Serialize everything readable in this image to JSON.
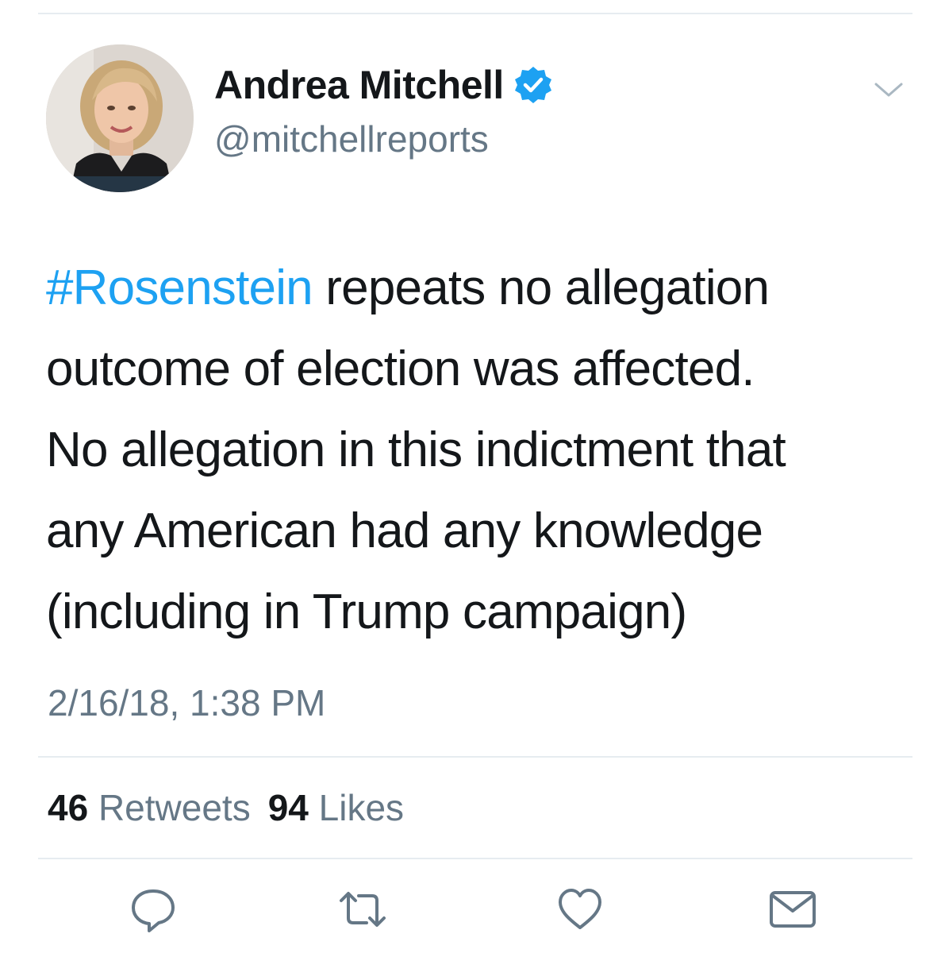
{
  "tweet": {
    "author": {
      "display_name": "Andrea Mitchell",
      "handle": "@mitchellreports",
      "verified": true
    },
    "text_lines": [
      {
        "hashtag": "#Rosenstein",
        "rest": " repeats no allegation"
      },
      {
        "text": "outcome of election was affected."
      },
      {
        "text": "No allegation in this indictment that"
      },
      {
        "text": "any American had any knowledge"
      },
      {
        "text": "(including in Trump campaign)"
      }
    ],
    "timestamp": "2/16/18, 1:38 PM",
    "stats": {
      "retweets_count": "46",
      "retweets_label": "Retweets",
      "likes_count": "94",
      "likes_label": "Likes"
    }
  },
  "icons": {
    "verified": "verified-badge-icon",
    "caret": "chevron-down-icon",
    "reply": "reply-icon",
    "retweet": "retweet-icon",
    "like": "heart-icon",
    "dm": "envelope-icon"
  },
  "colors": {
    "accent": "#1da1f2",
    "secondary_text": "#657786",
    "primary_text": "#14171a",
    "divider": "#e6ecf0"
  }
}
